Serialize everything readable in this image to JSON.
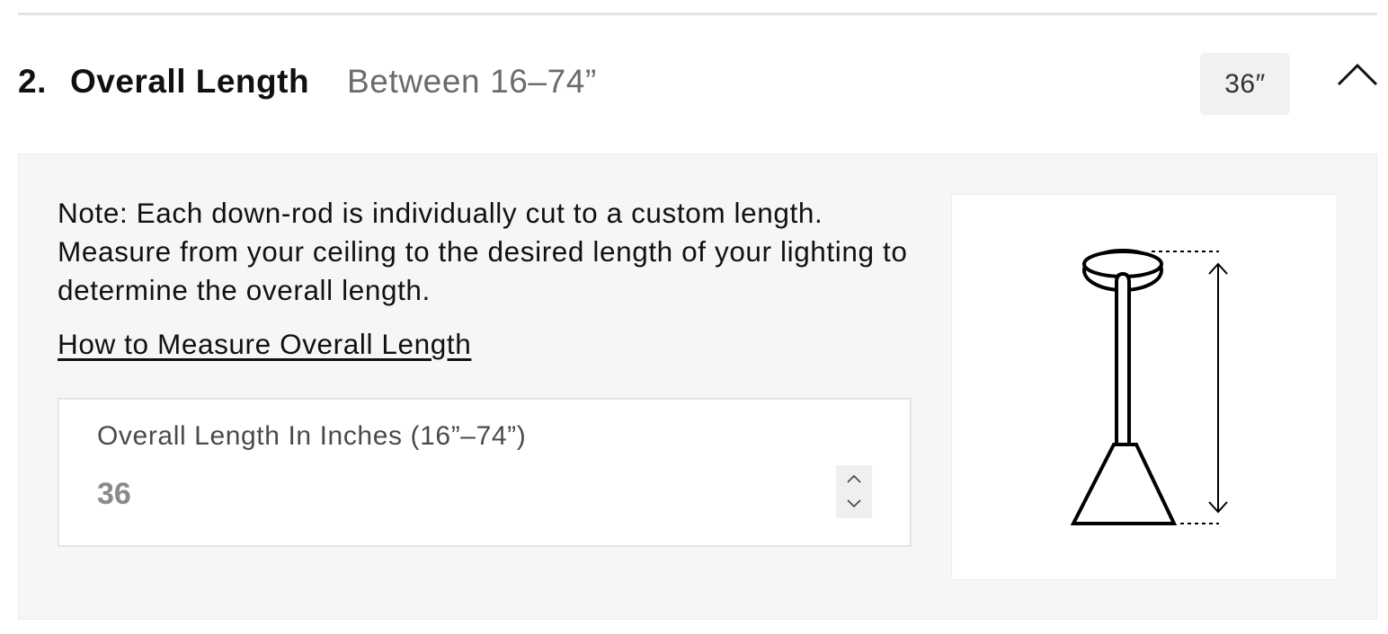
{
  "section": {
    "step_number": "2.",
    "title": "Overall Length",
    "range_text": "Between 16–74”",
    "selected_value": "36″"
  },
  "panel": {
    "note": "Note: Each down-rod is individually cut to a custom length. Measure from your ceiling to the desired length of your lighting to determine the overall length.",
    "link_label": "How to Measure Overall Length",
    "input": {
      "label": "Overall Length In Inches (16”–74”)",
      "value": "36"
    }
  },
  "icons": {
    "collapse": "chevron-up-icon",
    "stepper_up": "chevron-up-icon",
    "stepper_down": "chevron-down-icon",
    "diagram": "pendant-light-length-diagram"
  },
  "colors": {
    "panel_background": "#f6f6f6",
    "chip_background": "#f1f1f1",
    "text_primary": "#111111",
    "text_muted": "#6b6b6b"
  }
}
